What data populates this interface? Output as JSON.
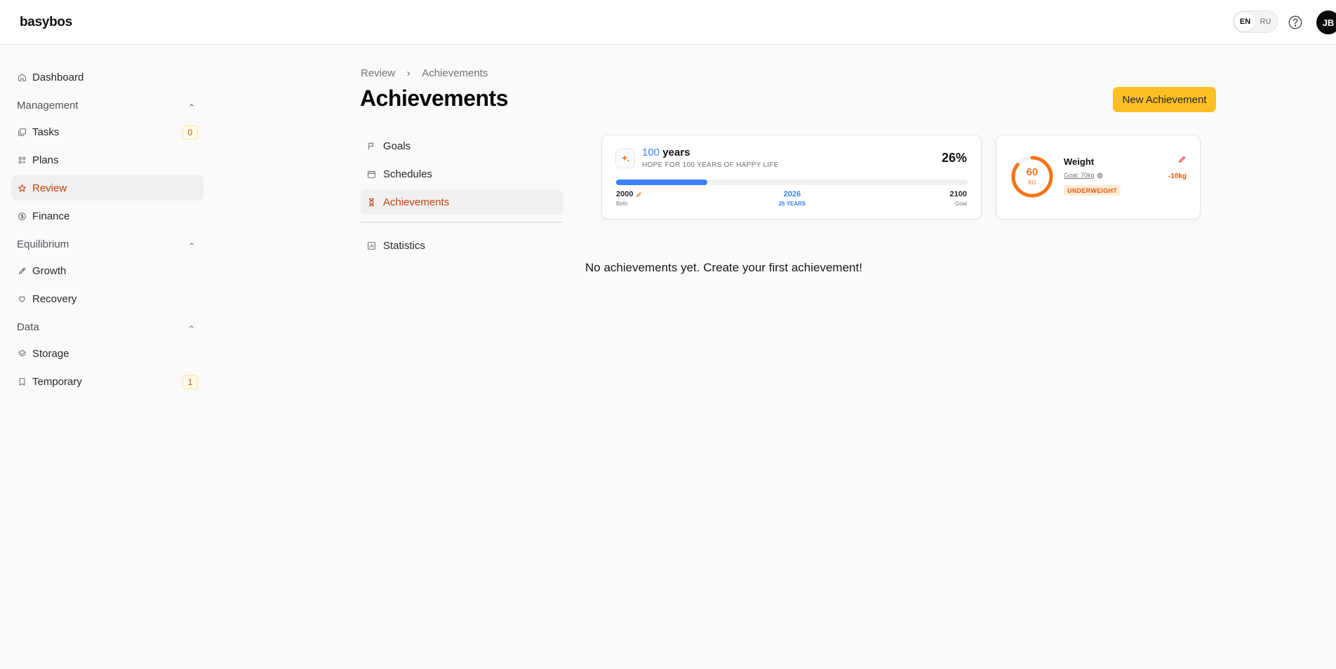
{
  "app": {
    "logo": "basybos"
  },
  "header": {
    "lang_options": [
      "EN",
      "RU"
    ],
    "lang_active": "EN",
    "user_initials": "JB"
  },
  "sidebar": {
    "dashboard": "Dashboard",
    "groups": [
      {
        "label": "Management",
        "items": [
          {
            "label": "Tasks",
            "badge": "0"
          },
          {
            "label": "Plans"
          },
          {
            "label": "Review"
          },
          {
            "label": "Finance"
          }
        ]
      },
      {
        "label": "Equilibrium",
        "items": [
          {
            "label": "Growth"
          },
          {
            "label": "Recovery"
          }
        ]
      },
      {
        "label": "Data",
        "items": [
          {
            "label": "Storage"
          },
          {
            "label": "Temporary",
            "badge": "1"
          }
        ]
      }
    ],
    "active": "Review"
  },
  "breadcrumb": [
    "Review",
    "Achievements"
  ],
  "page": {
    "title": "Achievements",
    "new_button": "New Achievement"
  },
  "subnav": {
    "items": [
      "Goals",
      "Schedules",
      "Achievements",
      "Statistics"
    ],
    "active": "Achievements"
  },
  "life_card": {
    "number": "100",
    "unit": "years",
    "subtitle": "HOPE FOR 100 YEARS OF HAPPY LIFE",
    "percent": "26%",
    "progress": 0.26,
    "start_year": "2000",
    "start_label": "Birth",
    "current_year": "2026",
    "current_label": "26 YEARS",
    "end_year": "2100",
    "end_label": "Goal"
  },
  "weight_card": {
    "value": "60",
    "unit": "KG",
    "title": "Weight",
    "goal": "Goal: 70kg",
    "status": "UNDERWEIGHT",
    "diff": "-10kg",
    "ring_fraction": 0.86
  },
  "empty_message": "No achievements yet. Create your first achievement!",
  "colors": {
    "accent": "#c2410c",
    "primary_button": "#fbbf24",
    "progress": "#3b82f6",
    "weight": "#f97316"
  }
}
